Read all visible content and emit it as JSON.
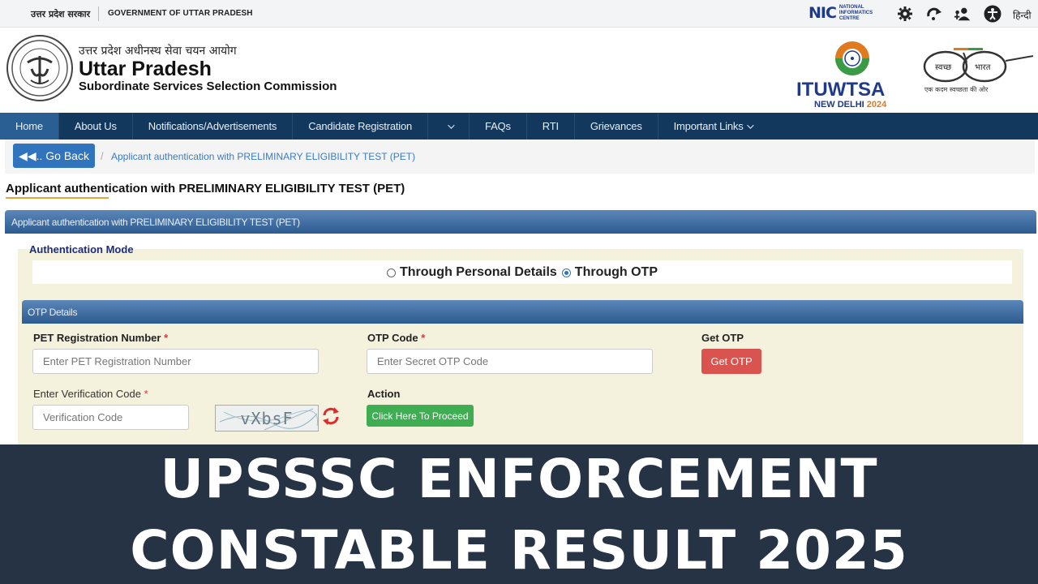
{
  "topbar": {
    "hindi_gov": "उत्तर प्रदेश सरकार",
    "english_gov": "GOVERNMENT OF UTTAR PRADESH",
    "nic_mark": "NIC",
    "nic_text": "NATIONAL INFORMATICS CENTRE",
    "icons": [
      "gear-icon",
      "redo-icon",
      "users-icon",
      "accessibility-icon"
    ],
    "language": "हिन्दी"
  },
  "header": {
    "hindi_name": "उत्तर प्रदेश अधीनस्थ सेवा चयन आयोग",
    "title": "Uttar Pradesh",
    "subtitle": "Subordinate Services Selection Commission",
    "itu_logo_text": "ITUWTSA",
    "itu_city": "NEW DELHI",
    "itu_year": "2024",
    "swachh_word1": "स्वच्छ",
    "swachh_word2": "भारत",
    "swachh_tagline": "एक कदम स्वच्छता की ओर"
  },
  "nav": {
    "items": [
      {
        "label": "Home",
        "active": true
      },
      {
        "label": "About Us"
      },
      {
        "label": "Notifications/Advertisements"
      },
      {
        "label": "Candidate Registration"
      },
      {
        "label": ""
      },
      {
        "label": "FAQs"
      },
      {
        "label": "RTI"
      },
      {
        "label": "Grievances"
      },
      {
        "label": "Important Links"
      }
    ]
  },
  "breadcrumb": {
    "go_back": "◀◀.. Go Back",
    "current": "Applicant authentication with PRELIMINARY ELIGIBILITY TEST (PET)"
  },
  "page": {
    "title": "Applicant authentication with PRELIMINARY ELIGIBILITY TEST (PET)",
    "panel_title": "Applicant authentication with PRELIMINARY ELIGIBILITY TEST (PET)",
    "auth_mode_label": "Authentication Mode",
    "auth_options": [
      "Through Personal Details",
      "Through OTP"
    ],
    "selected_option": "Through OTP",
    "otp_section_title": "OTP Details"
  },
  "form": {
    "pet_label": "PET Registration Number",
    "pet_placeholder": "Enter PET Registration Number",
    "otp_label": "OTP Code",
    "otp_placeholder": "Enter Secret OTP Code",
    "get_otp_label": "Get OTP",
    "get_otp_button": "Get OTP",
    "verification_label": "Enter Verification Code",
    "verification_placeholder": "Verification Code",
    "captcha_text": "vXbsF",
    "action_label": "Action",
    "proceed_button": "Click Here To Proceed",
    "required_mark": "*"
  },
  "banner": {
    "line1": "UPSSSC ENFORCEMENT",
    "line2": "CONSTABLE RESULT 2025"
  },
  "colors": {
    "nav_bg": "#13385e",
    "panel_head": "#2d5b90",
    "cream": "#f4f2dd",
    "btn_red": "#d9534f",
    "btn_green": "#3fae53",
    "banner_bg": "#263344"
  }
}
